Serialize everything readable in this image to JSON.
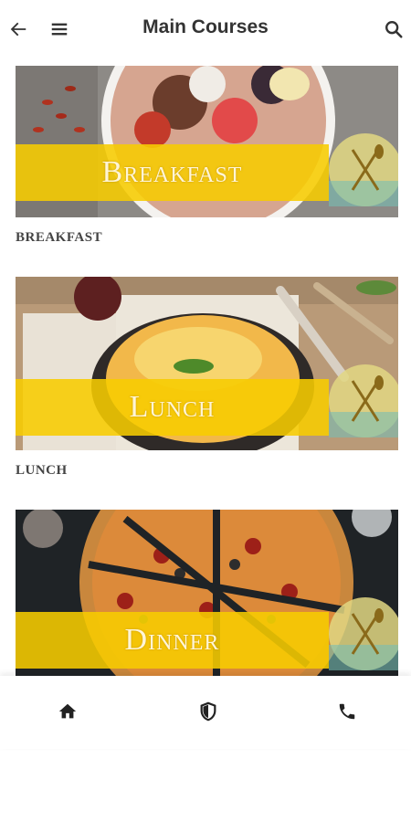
{
  "header": {
    "title": "Main Courses",
    "back_icon": "arrow-left-icon",
    "menu_icon": "hamburger-menu-icon",
    "search_icon": "search-icon"
  },
  "cards": [
    {
      "banner": "Breakfast",
      "label": "BREAKFAST"
    },
    {
      "banner": "Lunch",
      "label": "LUNCH"
    },
    {
      "banner": "Dinner",
      "label": ""
    }
  ],
  "bottom_nav": {
    "items": [
      "home-icon",
      "shield-icon",
      "phone-icon"
    ]
  },
  "colors": {
    "banner": "#f7cc00",
    "title": "#333333",
    "label": "#444444"
  }
}
